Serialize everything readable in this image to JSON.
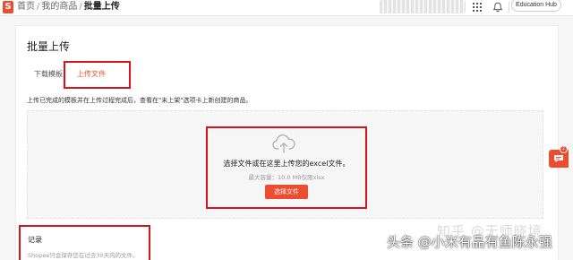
{
  "header": {
    "logo_letter": "S",
    "breadcrumb": [
      "首页",
      "我的商品",
      "批量上传"
    ],
    "separator": "/",
    "edu_hub_label": "Education Hub",
    "icons": [
      "grid-icon",
      "bell-icon"
    ]
  },
  "page": {
    "title": "批量上传",
    "tabs": [
      {
        "label": "下载模板",
        "active": false
      },
      {
        "label": "上传文件",
        "active": true
      }
    ],
    "info_text": "上传已完成的模板并在上传过程完成后，查看在\"未上架\"选项卡上新创建的商品。"
  },
  "upload": {
    "icon": "cloud-upload-icon",
    "title": "选择文件或在这里上传您的excel文件。",
    "hint": "最大容量：10.0 MB仅限xlsx",
    "button_label": "选择文件"
  },
  "records": {
    "title": "记录",
    "note": "Shopee只会保存您在过去30天内的文件。"
  },
  "chat": {
    "icon": "chat-icon",
    "badge_count": "2"
  },
  "watermarks": {
    "zhihu": "知乎 @无师晓境",
    "toutiao": "头条 @小米有品有鱼陈永强"
  },
  "colors": {
    "accent": "#ee4d2d",
    "annotation": "#d6141e",
    "background": "#f6f6f6"
  }
}
